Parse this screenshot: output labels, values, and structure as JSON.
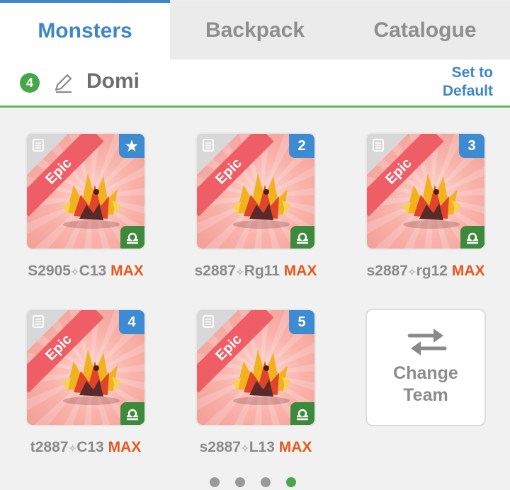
{
  "tabs": [
    {
      "label": "Monsters",
      "active": true
    },
    {
      "label": "Backpack",
      "active": false
    },
    {
      "label": "Catalogue",
      "active": false
    }
  ],
  "header": {
    "team_number": "4",
    "team_name": "Domi",
    "default_button": "Set to Default"
  },
  "monsters": [
    {
      "rarity": "Epic",
      "slot_badge": "★",
      "name": "S2905",
      "suffix": "C13",
      "level": "MAX",
      "element": "libra-icon"
    },
    {
      "rarity": "Epic",
      "slot_badge": "2",
      "name": "s2887",
      "suffix": "Rg11",
      "level": "MAX",
      "element": "libra-icon"
    },
    {
      "rarity": "Epic",
      "slot_badge": "3",
      "name": "s2887",
      "suffix": "rg12",
      "level": "MAX",
      "element": "libra-icon"
    },
    {
      "rarity": "Epic",
      "slot_badge": "4",
      "name": "t2887",
      "suffix": "C13",
      "level": "MAX",
      "element": "libra-icon"
    },
    {
      "rarity": "Epic",
      "slot_badge": "5",
      "name": "s2887",
      "suffix": "L13",
      "level": "MAX",
      "element": "libra-icon"
    }
  ],
  "change_team": {
    "line1": "Change",
    "line2": "Team"
  },
  "pagination": {
    "total": 4,
    "current": 4
  },
  "colors": {
    "accent_blue": "#3f86c6",
    "green": "#46a74a",
    "max_orange": "#e35a1e",
    "epic_red": "#ef5e67"
  }
}
